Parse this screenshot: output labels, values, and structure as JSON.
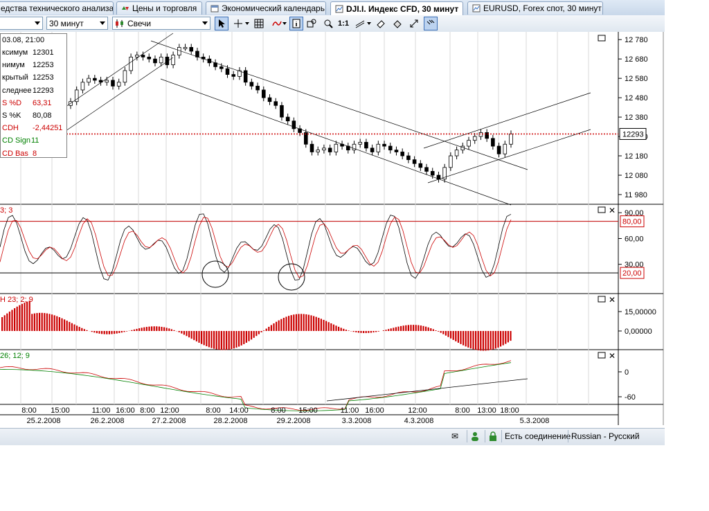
{
  "tabs": [
    {
      "label": "едства технического анализа",
      "icon": "",
      "active": false
    },
    {
      "label": "Цены и торговля",
      "icon": "price-trading-icon",
      "active": false
    },
    {
      "label": "Экономический календарь",
      "icon": "calendar-icon",
      "active": false
    },
    {
      "label": "DJI.I. Индекс CFD, 30 минут",
      "icon": "chart-icon",
      "active": true
    },
    {
      "label": "EURUSD, Forex спот, 30 минут",
      "icon": "chart-icon",
      "active": false
    }
  ],
  "toolbar": {
    "timeframe": "30 минут",
    "chart_type": "Свечи",
    "tools": [
      "cursor-icon",
      "crosshair-icon",
      "grid-icon",
      "indicator-icon",
      "info-icon",
      "zoom-in-window-icon",
      "zoom-icon",
      "one-to-one-icon",
      "line-tool-icon",
      "eraser-icon",
      "paint-icon",
      "resize-icon",
      "magnet-icon"
    ],
    "one_to_one_label": "1:1"
  },
  "info_panel": {
    "date": "03.08, 21:00",
    "rows": [
      {
        "key": "ксимум",
        "value": "12301",
        "color": "#000000"
      },
      {
        "key": "нимум",
        "value": "12253",
        "color": "#000000"
      },
      {
        "key": "крытый",
        "value": "12253",
        "color": "#000000"
      },
      {
        "key": "следнее",
        "value": "12293",
        "color": "#000000"
      },
      {
        "key": "S %D",
        "value": "63,31",
        "color": "#cc0000"
      },
      {
        "key": "S %K",
        "value": "80,08",
        "color": "#000000"
      },
      {
        "key": "CDH",
        "value": "-2,44251",
        "color": "#cc0000"
      },
      {
        "key": "CD Sign",
        "value": "11",
        "color": "#008000"
      },
      {
        "key": "CD Bas",
        "value": "8",
        "color": "#cc0000"
      }
    ]
  },
  "price_axis": [
    "12 780",
    "12 680",
    "12 580",
    "12 480",
    "12 380",
    "12 280",
    "12 180",
    "12 080",
    "11 980"
  ],
  "last_price": "12293",
  "stoch": {
    "label": "3; 3",
    "axis": [
      "90,00",
      "60,00",
      "30,00"
    ],
    "upper": "80,00",
    "lower": "20,00"
  },
  "macd_hist": {
    "label": "H 23; 2; 9",
    "axis": [
      "15,00000",
      "0,00000"
    ]
  },
  "macd": {
    "label": "26; 12; 9",
    "axis": [
      "0",
      "-60"
    ]
  },
  "time_axis": {
    "hours": [
      "8:00",
      "15:00",
      "11:00",
      "16:00",
      "8:00",
      "12:00",
      "8:00",
      "14:00",
      "8:00",
      "15:00",
      "11:00",
      "16:00",
      "12:00",
      "8:00",
      "13:00",
      "18:00"
    ],
    "dates": [
      "25.2.2008",
      "26.2.2008",
      "27.2.2008",
      "28.2.2008",
      "29.2.2008",
      "3.3.2008",
      "4.3.2008",
      "5.3.2008"
    ]
  },
  "status": {
    "connection": "Есть соединение",
    "language": "Russian - Русский"
  },
  "colors": {
    "price_line": "#cc0000",
    "stoch_k": "#000000",
    "stoch_d": "#cc0000",
    "hist": "#cc0000",
    "macd_line": "#008000",
    "signal_line": "#cc0000"
  }
}
